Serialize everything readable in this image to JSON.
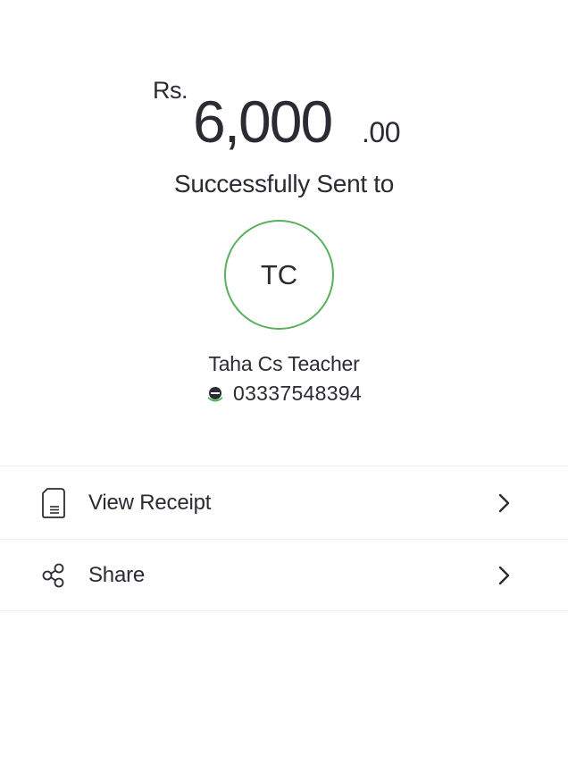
{
  "transfer": {
    "currency": "Rs.",
    "amount_whole": "6,000",
    "amount_cents": ".00",
    "status": "Successfully Sent to"
  },
  "recipient": {
    "initials": "TC",
    "name": "Taha Cs Teacher",
    "number": "03337548394",
    "wallet_icon": "easypaisa-logo-icon"
  },
  "actions": [
    {
      "label": "View Receipt",
      "icon": "receipt-icon"
    },
    {
      "label": "Share",
      "icon": "share-icon"
    }
  ],
  "colors": {
    "text": "#2b2b33",
    "avatar_ring": "#58b05a",
    "divider": "#ececef",
    "wallet_green": "#3cb54a"
  }
}
